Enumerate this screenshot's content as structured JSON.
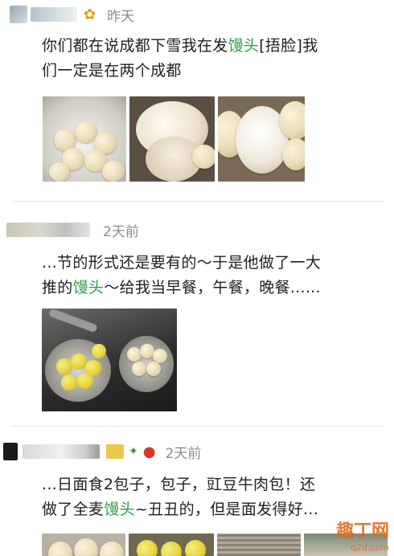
{
  "posts": [
    {
      "time": "昨天",
      "lines": [
        {
          "pre": "你们都在说成都下雪我在发",
          "hl": "馒头",
          "post": "[捂脸]我"
        },
        {
          "pre": "们一定是在两个成都",
          "hl": "",
          "post": ""
        }
      ],
      "photos": [
        "steamed-buns-in-pot",
        "torn-bun-close-up",
        "bun-split-open"
      ]
    },
    {
      "time": "2天前",
      "lines": [
        {
          "pre": "...节的形式还是要有的～于是他做了一大",
          "hl": "",
          "post": ""
        },
        {
          "pre": "推的",
          "hl": "馒头",
          "post": "～给我当早餐，午餐，晚餐......"
        }
      ],
      "photos": [
        "buns-in-steamer-on-stove"
      ]
    },
    {
      "time": "2天前",
      "lines": [
        {
          "pre": "...日面食2包子，包子，豇豆牛肉包！还",
          "hl": "",
          "post": ""
        },
        {
          "pre": "做了全麦",
          "hl": "馒头",
          "post": "~丑丑的，但是面发得好..."
        }
      ],
      "photos": [
        "buns-partial-1",
        "buns-partial-2",
        "buns-partial-3",
        "buns-partial-4"
      ]
    }
  ],
  "watermark": {
    "title": "趣丁网",
    "url": "q2d.com"
  },
  "colors": {
    "highlight": "#2f9e44",
    "time": "#8c8c8c"
  }
}
